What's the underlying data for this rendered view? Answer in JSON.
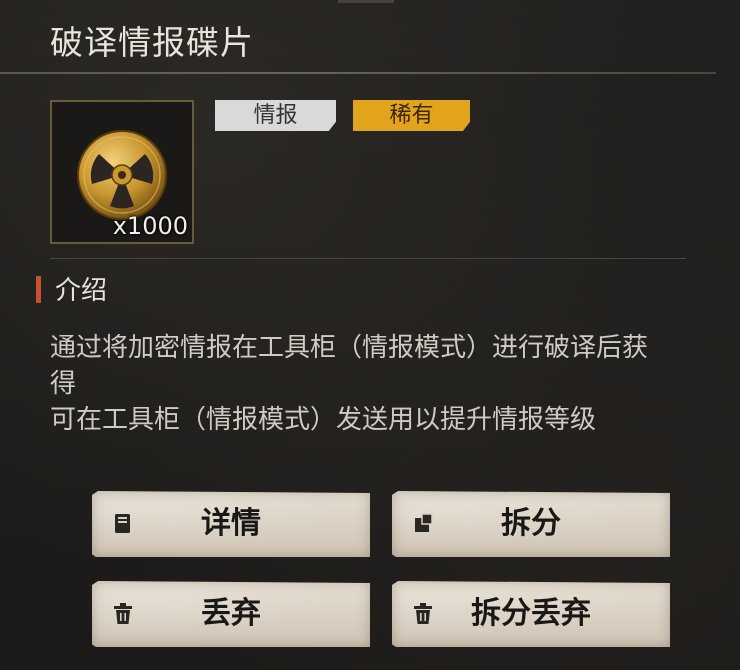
{
  "title": "破译情报碟片",
  "item": {
    "count": "x1000",
    "icon": "film-reel-icon"
  },
  "tags": [
    {
      "label": "情报",
      "color": "#d9d9d9"
    },
    {
      "label": "稀有",
      "color": "#e3a41d"
    }
  ],
  "section": {
    "title": "介绍",
    "accent": "#c9502c"
  },
  "description": [
    "通过将加密情报在工具柜（情报模式）进行破译后获得",
    "可在工具柜（情报模式）发送用以提升情报等级"
  ],
  "buttons": [
    {
      "label": "详情",
      "icon": "book-icon"
    },
    {
      "label": "拆分",
      "icon": "split-icon"
    },
    {
      "label": "丢弃",
      "icon": "trash-icon"
    },
    {
      "label": "拆分丢弃",
      "icon": "trash-icon"
    }
  ]
}
